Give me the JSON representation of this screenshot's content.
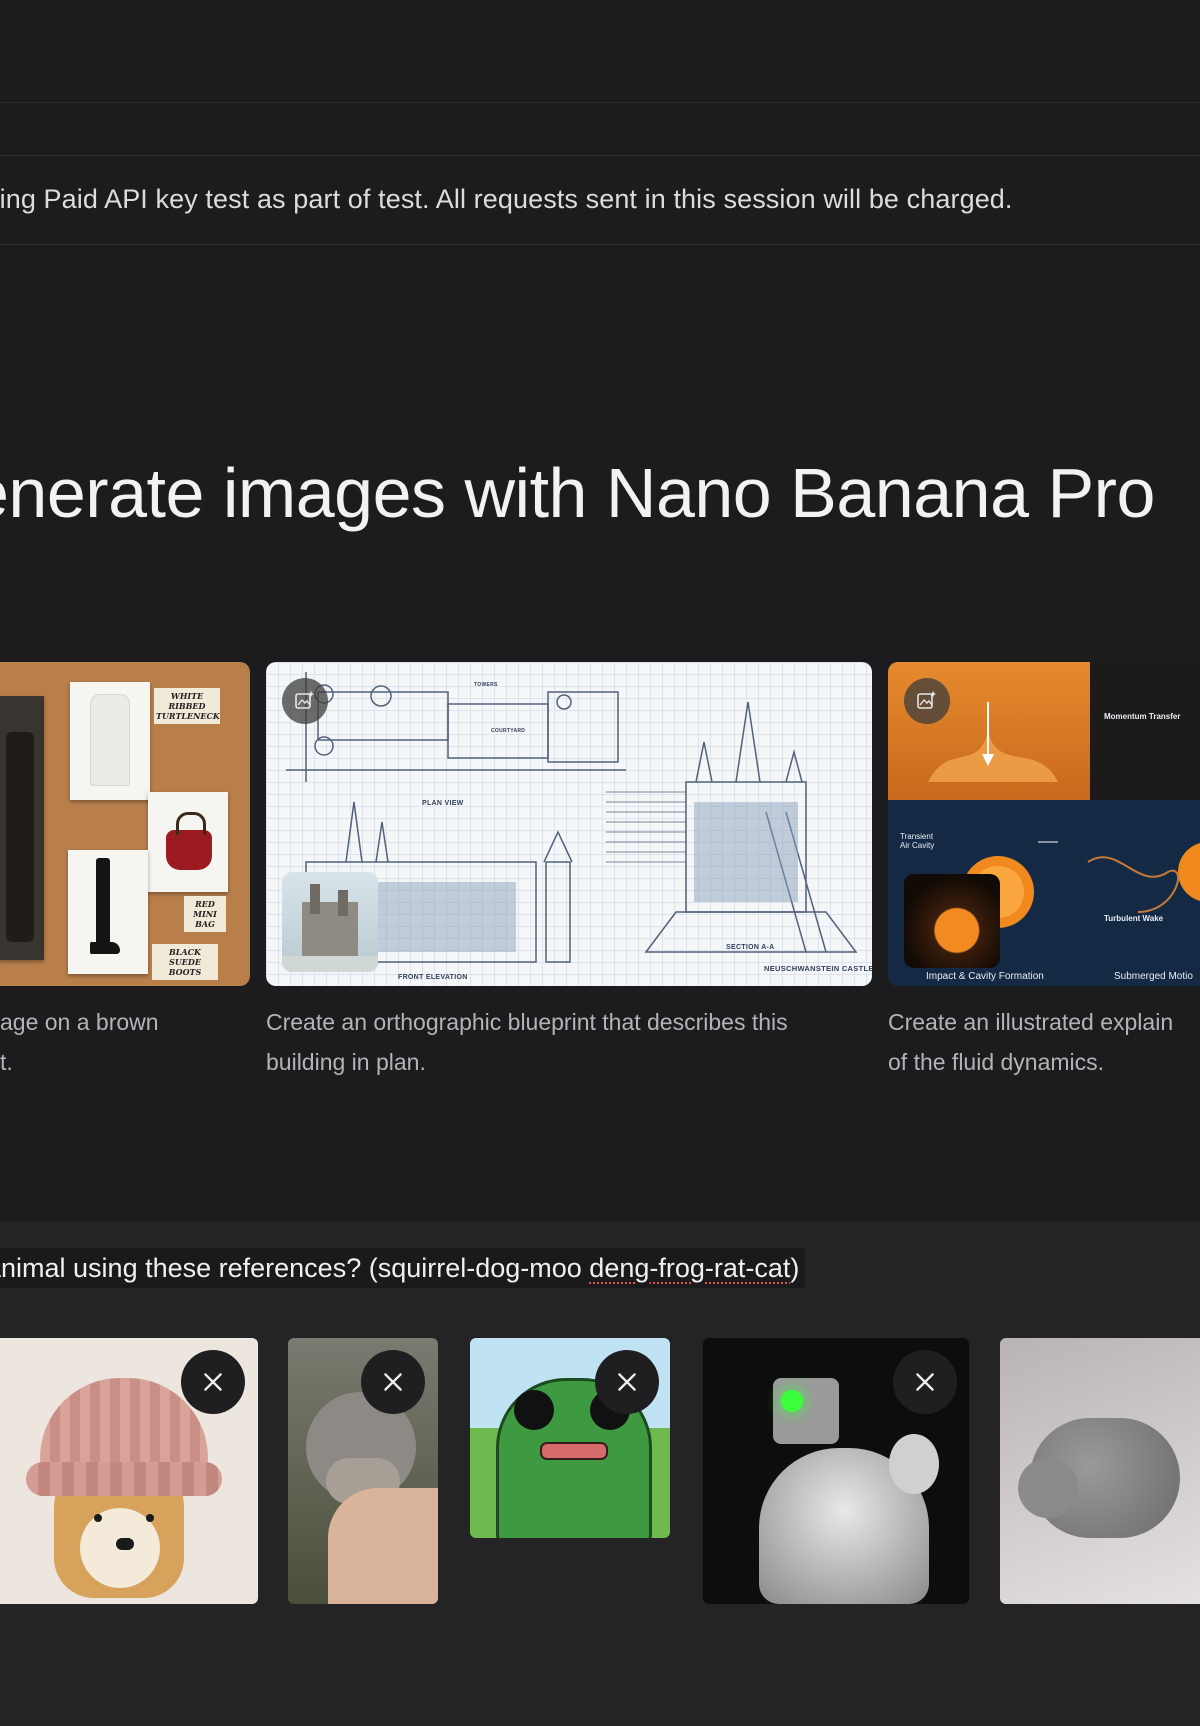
{
  "notice": {
    "text": "sing Paid API key test as part of test. All requests sent in this session will be charged."
  },
  "hero": {
    "title": "enerate images with Nano Banana Pro"
  },
  "examples": [
    {
      "caption": "age on a brown\nt.",
      "tags": [
        "WHITE RIBBED TURTLENECK",
        "RED MINI BAG",
        "BLACK SUEDE BOOTS"
      ]
    },
    {
      "caption": "Create an orthographic blueprint that describes this\nbuilding in plan.",
      "labels": [
        "PLAN VIEW",
        "FRONT ELEVATION",
        "SECTION A-A",
        "NEUSCHWANSTEIN CASTLE",
        "COURTYARD",
        "TOWERS"
      ]
    },
    {
      "caption": "Create an illustrated explain\nof the fluid dynamics.",
      "labels": [
        "Momentum Transfer",
        "Transient Air Cavity",
        "Turbulent Wake",
        "Impact & Cavity Formation",
        "Submerged Motio"
      ]
    }
  ],
  "prompt": {
    "before": "animal using these references? (squirrel-dog-moo ",
    "misspelled": "deng-frog-rat-cat",
    "after": ")"
  },
  "references": [
    {
      "name": "doge"
    },
    {
      "name": "moo deng"
    },
    {
      "name": "frog"
    },
    {
      "name": "rat"
    },
    {
      "name": "cat"
    }
  ],
  "icons": {
    "remove": "close-icon",
    "edit": "image-edit-icon"
  }
}
